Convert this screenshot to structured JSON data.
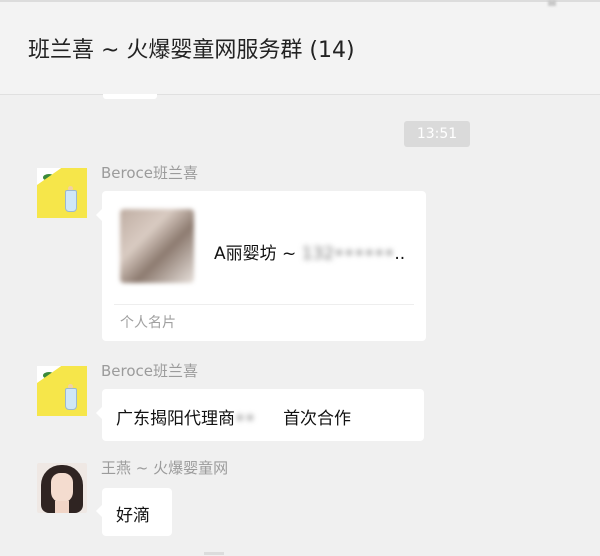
{
  "window": {
    "title": "班兰喜 ~ 火爆婴童网服务群 (14)"
  },
  "chat": {
    "timestamp": "13:51",
    "messages": [
      {
        "sender": "Beroce班兰喜",
        "type": "card",
        "card": {
          "name": "A丽婴坊 ~ ",
          "phone": "132••••••",
          "label": "个人名片"
        }
      },
      {
        "sender": "Beroce班兰喜",
        "type": "text",
        "text_before": "广东揭阳代理商",
        "text_redacted": "••",
        "text_after": "首次合作"
      },
      {
        "sender": "王燕 ~ 火爆婴童网",
        "type": "text",
        "text": "好滴"
      }
    ]
  },
  "icons": {
    "avatar_1": "brand-logo-avatar",
    "avatar_2": "brand-logo-avatar",
    "avatar_3": "user-photo-avatar"
  }
}
